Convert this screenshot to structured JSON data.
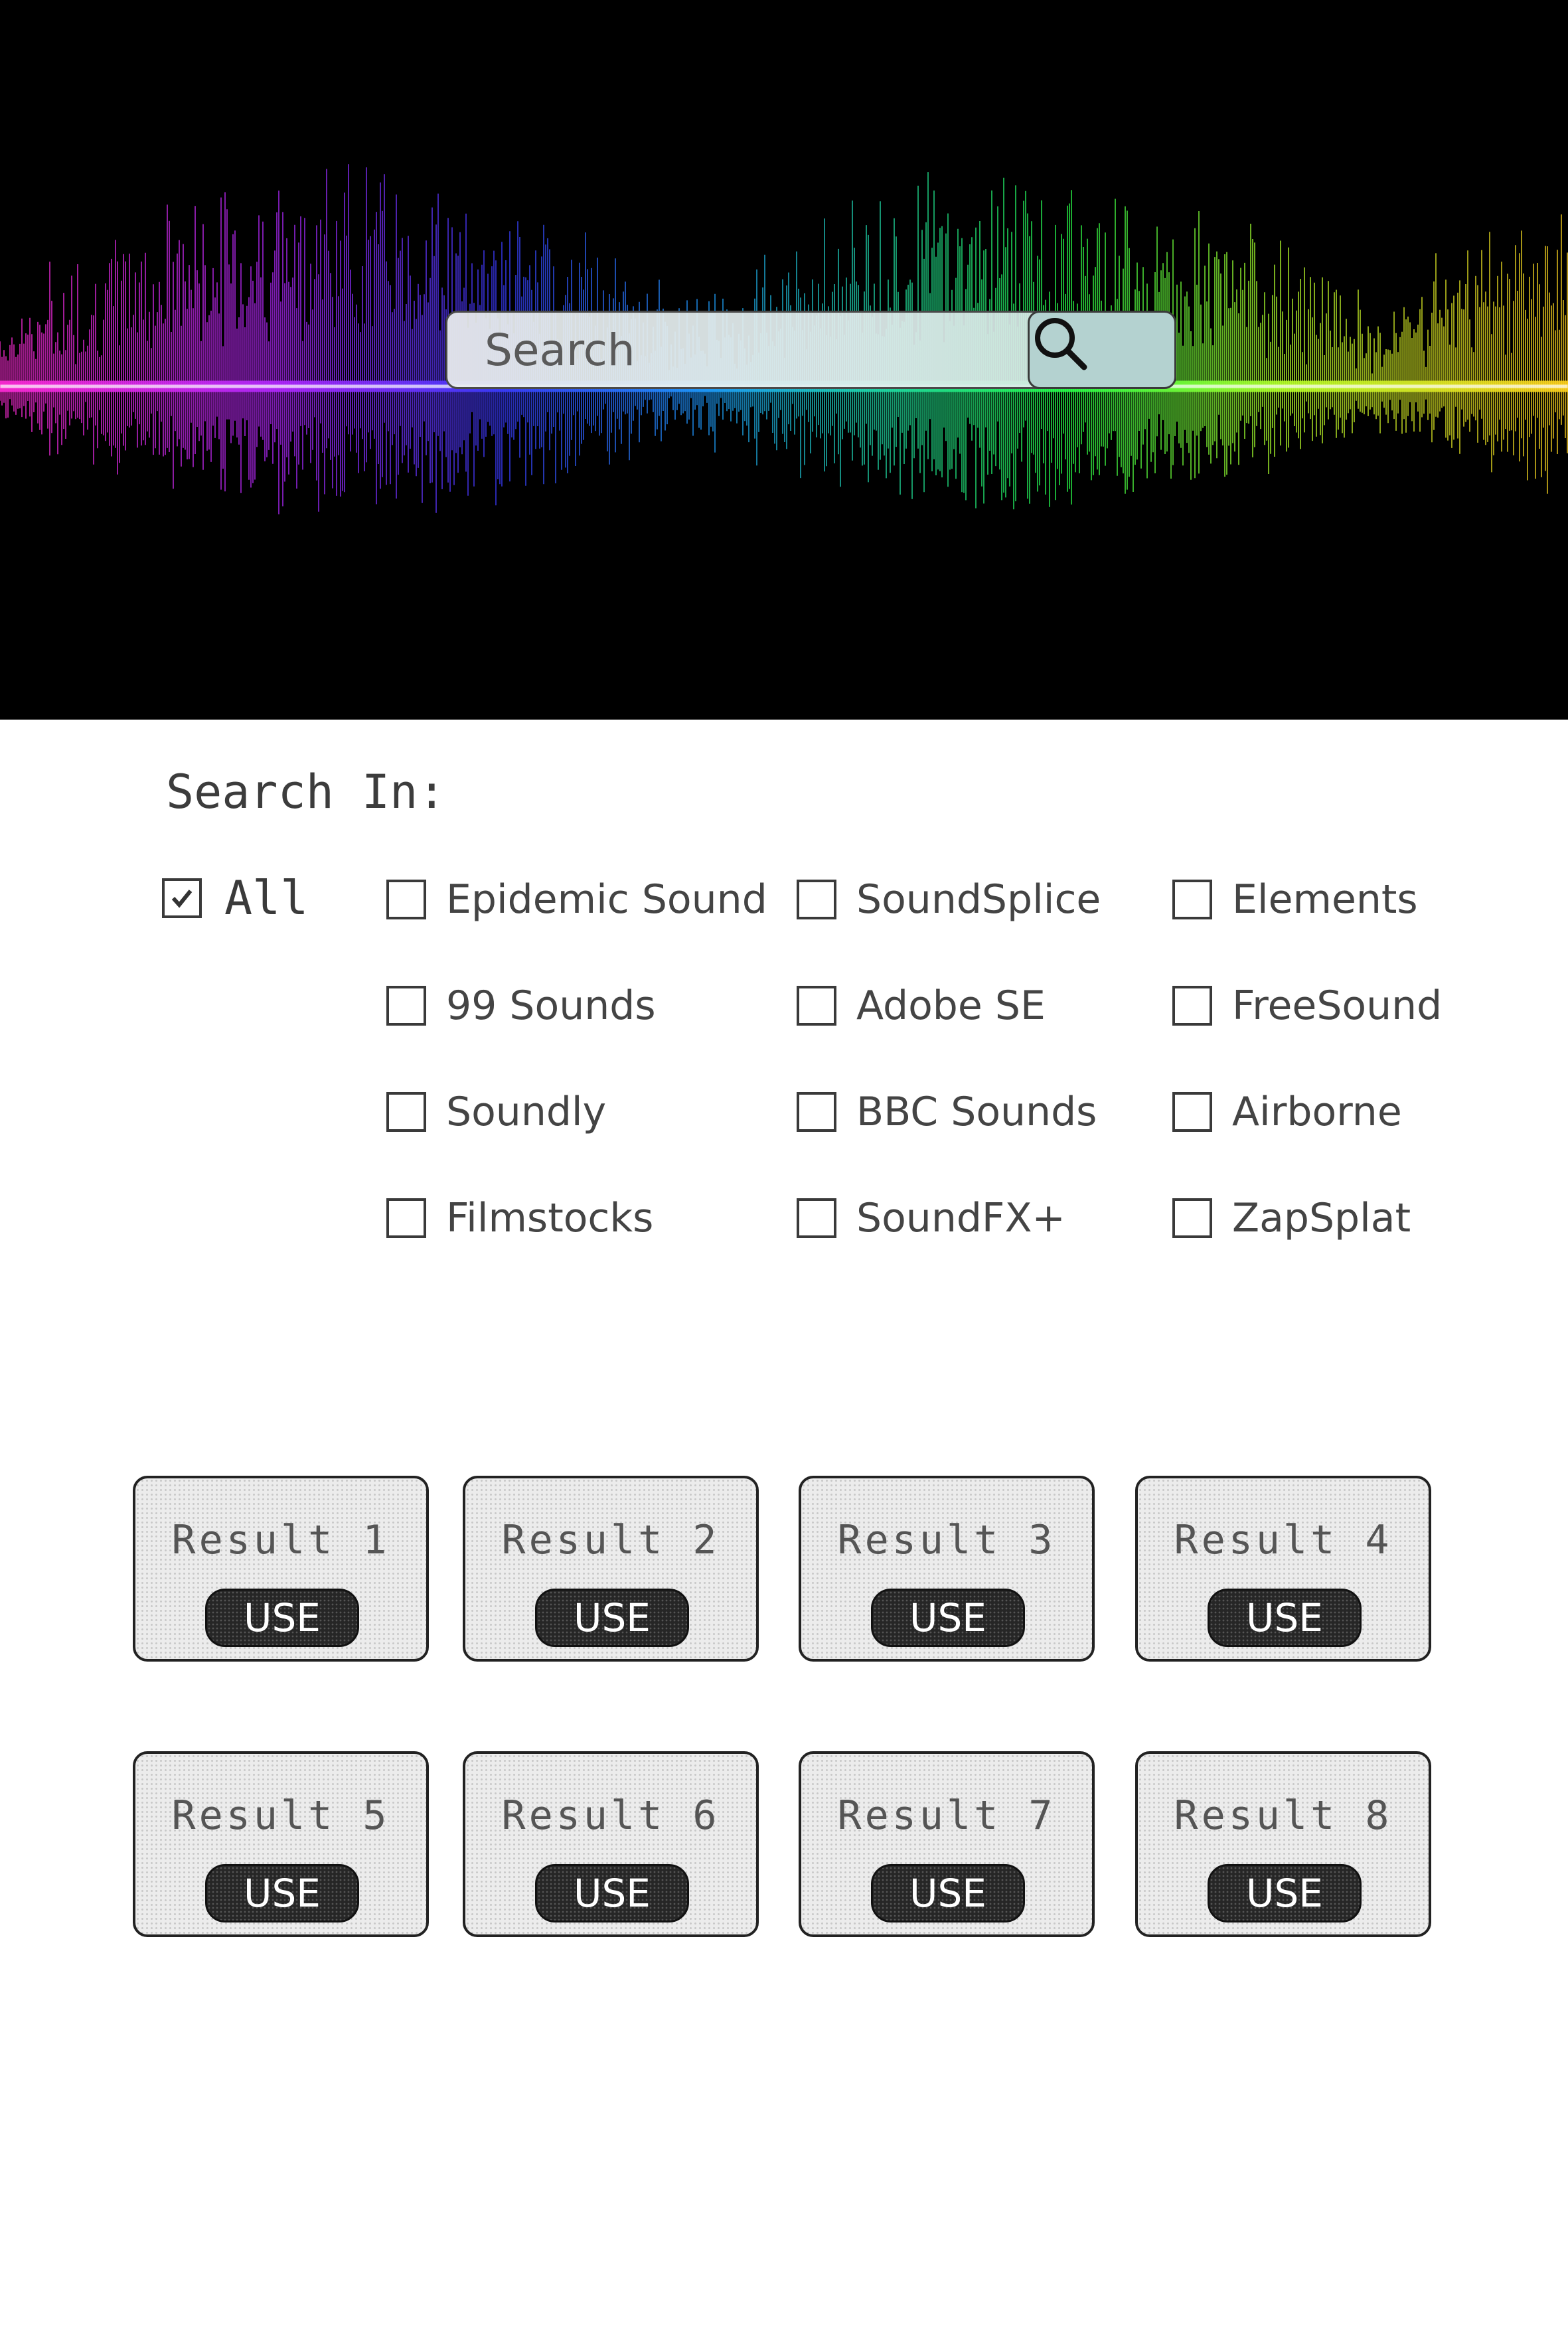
{
  "search": {
    "placeholder": "Search"
  },
  "search_in": {
    "title": "Search In:",
    "all": {
      "label": "All",
      "checked": true
    },
    "sources": [
      {
        "label": "Epidemic Sound",
        "checked": false
      },
      {
        "label": "99 Sounds",
        "checked": false
      },
      {
        "label": "Soundly",
        "checked": false
      },
      {
        "label": "Filmstocks",
        "checked": false
      },
      {
        "label": "SoundSplice",
        "checked": false
      },
      {
        "label": "Adobe SE",
        "checked": false
      },
      {
        "label": "BBC Sounds",
        "checked": false
      },
      {
        "label": "SoundFX+",
        "checked": false
      },
      {
        "label": "Elements",
        "checked": false
      },
      {
        "label": "FreeSound",
        "checked": false
      },
      {
        "label": "Airborne",
        "checked": false
      },
      {
        "label": "ZapSplat",
        "checked": false
      }
    ]
  },
  "results": [
    {
      "title": "Result 1",
      "button": "USE"
    },
    {
      "title": "Result 2",
      "button": "USE"
    },
    {
      "title": "Result 3",
      "button": "USE"
    },
    {
      "title": "Result 4",
      "button": "USE"
    },
    {
      "title": "Result 5",
      "button": "USE"
    },
    {
      "title": "Result 6",
      "button": "USE"
    },
    {
      "title": "Result 7",
      "button": "USE"
    },
    {
      "title": "Result 8",
      "button": "USE"
    }
  ],
  "colors": {
    "banner_background": "#000000",
    "search_button": "#b4d2d0",
    "use_button": "#262626",
    "card_background": "#ececec"
  },
  "icons": {
    "search_button": "magnifier-icon",
    "checkbox_checked": "checkmark-icon"
  }
}
